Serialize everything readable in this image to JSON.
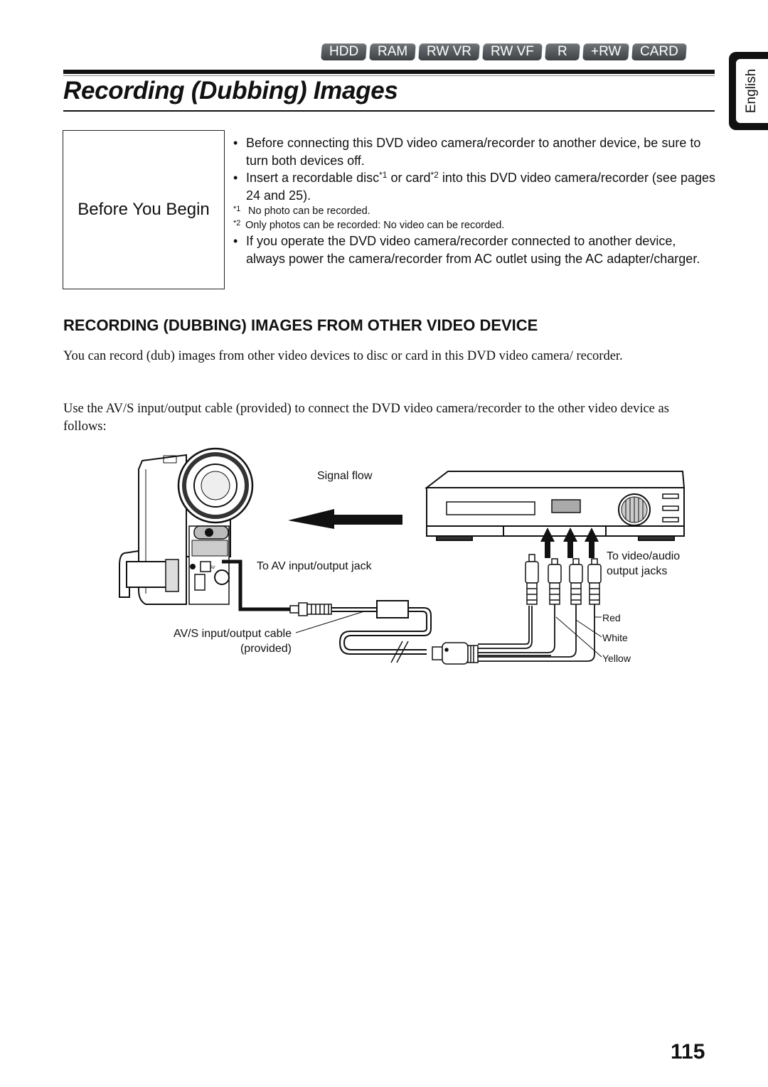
{
  "media_badges": [
    "HDD",
    "RAM",
    "RW VR",
    "RW VF",
    "R",
    "+RW",
    "CARD"
  ],
  "language_tab": "English",
  "page_title": "Recording (Dubbing) Images",
  "before_you_begin": {
    "label": "Before You Begin",
    "bullet_1": "Before connecting this DVD video camera/recorder to another device, be sure to turn both devices off.",
    "bullet_2_pre": "Insert a recordable disc",
    "bullet_2_sup1": "*1",
    "bullet_2_mid": " or card",
    "bullet_2_sup2": "*2",
    "bullet_2_post": " into this DVD video camera/recorder (see pages 24 and 25).",
    "note_1_mark": "*1",
    "note_1": "No photo can be recorded.",
    "note_2_mark": "*2",
    "note_2": "Only photos can be recorded: No video can be recorded.",
    "bullet_3": "If you operate the DVD video camera/recorder connected to another device, always power the camera/recorder from AC outlet using the AC adapter/charger."
  },
  "section": {
    "heading": "RECORDING (DUBBING) IMAGES FROM OTHER VIDEO DEVICE",
    "paragraph_1": "You can record (dub) images from other video devices to disc or card in this DVD video camera/ recorder.",
    "paragraph_2": "Use the AV/S  input/output cable (provided) to connect the DVD video camera/recorder to the other video device as follows:"
  },
  "diagram": {
    "signal_flow": "Signal flow",
    "av_jack_label": "To AV input/output jack",
    "cable_label_1": "AV/S input/output cable",
    "cable_label_2": "(provided)",
    "device_jacks_label_1": "To video/audio",
    "device_jacks_label_2": "output jacks",
    "plug_red": "Red",
    "plug_white": "White",
    "plug_yellow": "Yellow",
    "camera_av_marking": "AV"
  },
  "page_number": "115"
}
